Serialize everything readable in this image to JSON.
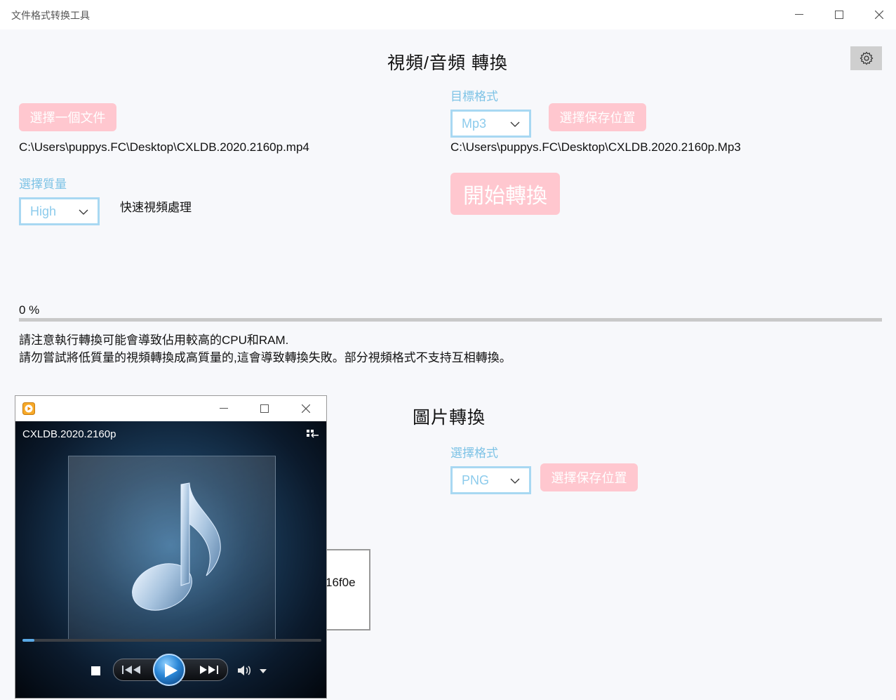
{
  "window": {
    "title": "文件格式转换工具"
  },
  "video_section": {
    "heading": "視頻/音頻 轉換",
    "choose_file_button": "選擇一個文件",
    "source_path": "C:\\Users\\puppys.FC\\Desktop\\CXLDB.2020.2160p.mp4",
    "quality_label": "選擇質量",
    "quality_value": "High",
    "fast_process_label": "快速視頻處理",
    "target_format_label": "目標格式",
    "target_format_value": "Mp3",
    "save_location_button": "選擇保存位置",
    "output_path": "C:\\Users\\puppys.FC\\Desktop\\CXLDB.2020.2160p.Mp3",
    "start_button": "開始轉換",
    "progress_text": "0 %",
    "progress": 0,
    "notes": [
      "請注意執行轉換可能會導致佔用較高的CPU和RAM.",
      "請勿嘗試將低質量的視頻轉換成高質量的,這會導致轉換失敗。部分視頻格式不支持互相轉換。"
    ]
  },
  "image_section": {
    "heading": "圖片轉換",
    "format_label": "選擇格式",
    "format_value": "PNG",
    "save_location_button": "選擇保存位置",
    "partial_text": "16f0e"
  },
  "media_player": {
    "video_name": "CXLDB.2020.2160p",
    "progress": 0.04
  },
  "colors": {
    "accent_pink": "#ffc7cf",
    "label_blue": "#7ec3e6",
    "select_border": "#a8d8f2"
  },
  "icons": [
    "settings-gear-icon",
    "minimize-icon",
    "maximize-icon",
    "close-icon",
    "chevron-down-icon",
    "music-note-icon",
    "play-icon",
    "stop-icon",
    "previous-icon",
    "next-icon",
    "volume-icon",
    "switch-view-icon"
  ]
}
